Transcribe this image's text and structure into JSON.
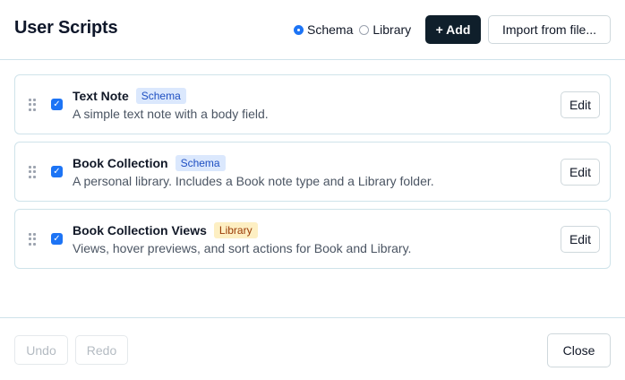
{
  "dialog": {
    "title": "User Scripts",
    "view_options": [
      {
        "label": "Schema",
        "selected": true
      },
      {
        "label": "Library",
        "selected": false
      }
    ],
    "add_label": "+ Add",
    "import_label": "Import from file..."
  },
  "scripts": [
    {
      "name": "Text Note",
      "badge": "Schema",
      "badge_kind": "schema",
      "description": "A simple text note with a body field.",
      "enabled": true,
      "edit_label": "Edit"
    },
    {
      "name": "Book Collection",
      "badge": "Schema",
      "badge_kind": "schema",
      "description": "A personal library. Includes a Book note type and a Library folder.",
      "enabled": true,
      "edit_label": "Edit"
    },
    {
      "name": "Book Collection Views",
      "badge": "Library",
      "badge_kind": "library",
      "description": "Views, hover previews, and sort actions for Book and Library.",
      "enabled": true,
      "edit_label": "Edit"
    }
  ],
  "footer": {
    "undo_label": "Undo",
    "redo_label": "Redo",
    "close_label": "Close"
  },
  "icons": {
    "drag_handle": "drag-handle-icon",
    "checkbox": "checkmark-icon"
  },
  "colors": {
    "primary_button": "#0f1f2b",
    "accent": "#1d74f5",
    "schema_badge_bg": "#dbe8fd",
    "schema_badge_text": "#1e4fc2",
    "library_badge_bg": "#fdefc3",
    "library_badge_text": "#9a3b06",
    "border": "#cfe3ea"
  }
}
